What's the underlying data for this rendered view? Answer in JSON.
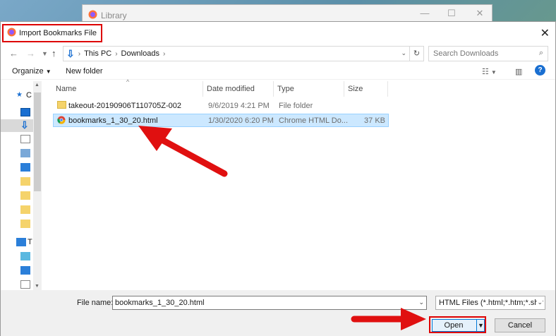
{
  "background_window": {
    "title": "Library"
  },
  "dialog": {
    "title": "Import Bookmarks File",
    "breadcrumb": [
      "This PC",
      "Downloads"
    ],
    "search_placeholder": "Search Downloads",
    "toolbar": {
      "organize": "Organize",
      "new_folder": "New folder"
    },
    "columns": [
      "Name",
      "Date modified",
      "Type",
      "Size"
    ],
    "rows": [
      {
        "name": "takeout-20190906T110705Z-002",
        "date": "9/6/2019 4:21 PM",
        "type": "File folder",
        "size": "",
        "icon": "folder-icon"
      },
      {
        "name": "bookmarks_1_30_20.html",
        "date": "1/30/2020 6:20 PM",
        "type": "Chrome HTML Do...",
        "size": "37 KB",
        "icon": "chrome-icon"
      }
    ],
    "nav_labels": [
      "C",
      "T"
    ],
    "file_name_label": "File name:",
    "file_name_value": "bookmarks_1_30_20.html",
    "file_type_value": "HTML Files (*.html;*.htm;*.shtr",
    "open_label": "Open",
    "cancel_label": "Cancel"
  },
  "colors": {
    "highlight": "#dd0000",
    "selection": "#cce8ff",
    "accent": "#0078d7"
  }
}
